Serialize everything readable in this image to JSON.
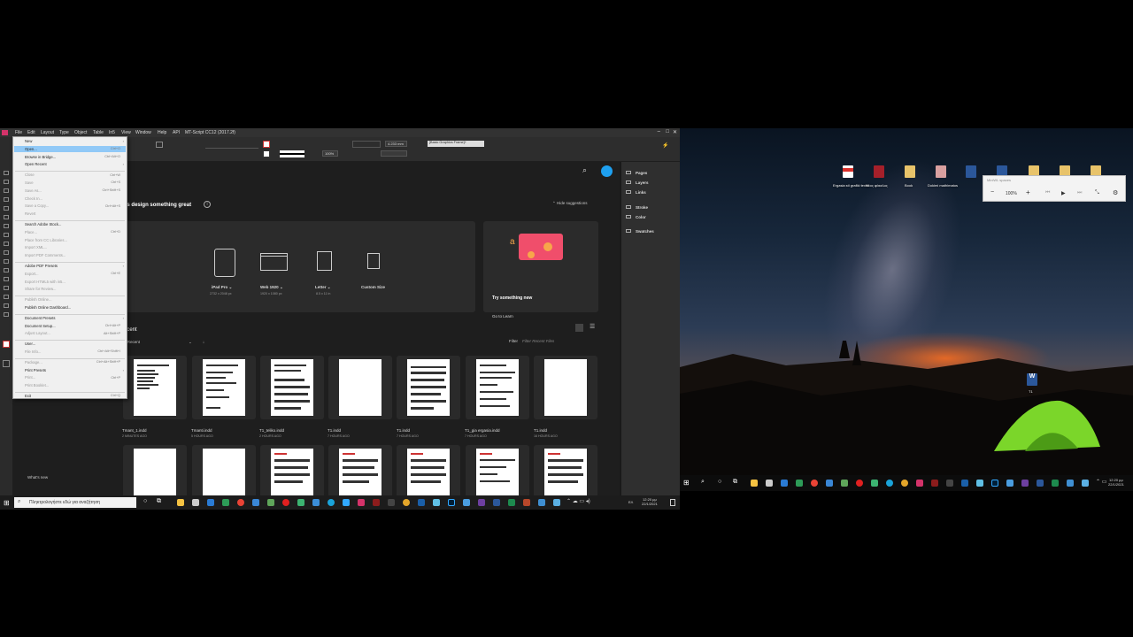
{
  "indesign": {
    "menubar": [
      "File",
      "Edit",
      "Layout",
      "Type",
      "Object",
      "Table",
      "In5",
      "View",
      "Window",
      "Help",
      "API",
      "MT-Script CC12 (2017.2f)"
    ],
    "control_fields": {
      "zoom": "100%",
      "size": "4.233 mm",
      "style": "[Basic Graphics Frame]+",
      "percent": "100%"
    },
    "file_menu": [
      {
        "label": "New",
        "shortcut": "",
        "sub": true,
        "disabled": false
      },
      {
        "label": "Open...",
        "shortcut": "Ctrl+O",
        "sub": false,
        "disabled": false,
        "highlight": true
      },
      {
        "label": "Browse in Bridge...",
        "shortcut": "Ctrl+Alt+O",
        "sub": false,
        "disabled": false
      },
      {
        "label": "Open Recent",
        "shortcut": "",
        "sub": true,
        "disabled": false
      },
      {
        "sep": true
      },
      {
        "label": "Close",
        "shortcut": "Ctrl+W",
        "sub": false,
        "disabled": true
      },
      {
        "label": "Save",
        "shortcut": "Ctrl+S",
        "sub": false,
        "disabled": true
      },
      {
        "label": "Save As...",
        "shortcut": "Ctrl+Shift+S",
        "sub": false,
        "disabled": true
      },
      {
        "label": "Check In...",
        "shortcut": "",
        "sub": false,
        "disabled": true
      },
      {
        "label": "Save a Copy...",
        "shortcut": "Ctrl+Alt+S",
        "sub": false,
        "disabled": true
      },
      {
        "label": "Revert",
        "shortcut": "",
        "sub": false,
        "disabled": true
      },
      {
        "sep": true
      },
      {
        "label": "Search Adobe Stock...",
        "shortcut": "",
        "sub": false,
        "disabled": false
      },
      {
        "label": "Place...",
        "shortcut": "Ctrl+D",
        "sub": false,
        "disabled": true
      },
      {
        "label": "Place from CC Libraries...",
        "shortcut": "",
        "sub": false,
        "disabled": true
      },
      {
        "label": "Import XML...",
        "shortcut": "",
        "sub": false,
        "disabled": true
      },
      {
        "label": "Import PDF Comments...",
        "shortcut": "",
        "sub": false,
        "disabled": true
      },
      {
        "sep": true
      },
      {
        "label": "Adobe PDF Presets",
        "shortcut": "",
        "sub": true,
        "disabled": false
      },
      {
        "label": "Export...",
        "shortcut": "Ctrl+E",
        "sub": false,
        "disabled": true
      },
      {
        "label": "Export HTML5 with in5...",
        "shortcut": "",
        "sub": false,
        "disabled": true
      },
      {
        "label": "Share for Review...",
        "shortcut": "",
        "sub": false,
        "disabled": true
      },
      {
        "sep": true
      },
      {
        "label": "Publish Online...",
        "shortcut": "",
        "sub": false,
        "disabled": true
      },
      {
        "label": "Publish Online Dashboard...",
        "shortcut": "",
        "sub": false,
        "disabled": false
      },
      {
        "sep": true
      },
      {
        "label": "Document Presets",
        "shortcut": "",
        "sub": true,
        "disabled": false
      },
      {
        "label": "Document Setup...",
        "shortcut": "Ctrl+Alt+P",
        "sub": false,
        "disabled": false
      },
      {
        "label": "Adjust Layout...",
        "shortcut": "Alt+Shift+P",
        "sub": false,
        "disabled": true
      },
      {
        "sep": true
      },
      {
        "label": "User...",
        "shortcut": "",
        "sub": false,
        "disabled": false
      },
      {
        "label": "File Info...",
        "shortcut": "Ctrl+Alt+Shift+I",
        "sub": false,
        "disabled": true
      },
      {
        "sep": true
      },
      {
        "label": "Package...",
        "shortcut": "Ctrl+Alt+Shift+P",
        "sub": false,
        "disabled": true
      },
      {
        "label": "Print Presets",
        "shortcut": "",
        "sub": true,
        "disabled": false
      },
      {
        "label": "Print...",
        "shortcut": "Ctrl+P",
        "sub": false,
        "disabled": true
      },
      {
        "label": "Print Booklet...",
        "shortcut": "",
        "sub": false,
        "disabled": true
      },
      {
        "sep": true
      },
      {
        "label": "Exit",
        "shortcut": "Ctrl+Q",
        "sub": false,
        "disabled": false
      }
    ],
    "home": {
      "headline": "t's design something great",
      "hide_suggestions": "Hide suggestions",
      "presets": [
        {
          "name": "iPad Pro",
          "size": "2732 x 2048 px"
        },
        {
          "name": "Web 1920",
          "size": "1920 x 1080 px"
        },
        {
          "name": "Letter",
          "size": "8.5 x 11 in"
        },
        {
          "name": "Custom Size",
          "size": ""
        }
      ],
      "try_title": "Try something new",
      "try_link": "Go to Learn",
      "recent_title": "ecent",
      "sort_label": "Recent",
      "sort_prefix": "t:",
      "filter_label": "Filter",
      "filter_placeholder": "Filter Recent Files",
      "files": [
        {
          "name": "Tmant_1.indd",
          "time": "2 MINUTES AGO"
        },
        {
          "name": "Tmanti.indd",
          "time": "5 HOURS AGO"
        },
        {
          "name": "T1_teliko.indd",
          "time": "2 HOURS AGO"
        },
        {
          "name": "T1.indd",
          "time": "7 HOURS AGO"
        },
        {
          "name": "T1.indd",
          "time": "7 HOURS AGO"
        },
        {
          "name": "T1_gia ergasia.indd",
          "time": "7 HOURS AGO"
        },
        {
          "name": "T1.indd",
          "time": "16 HOURS AGO"
        }
      ],
      "whats_new": "What's new"
    },
    "panels": [
      "Pages",
      "Layers",
      "Links",
      "Stroke",
      "Color",
      "Swatches"
    ]
  },
  "taskbar_left": {
    "search_placeholder": "Πληκτρολογήστε εδώ για αναζήτηση",
    "time": "12:20 μμ",
    "date": "22/1/2021",
    "lang": "ΕΛ"
  },
  "desktop": {
    "icons": [
      "Ergasia sti grafiki texni",
      "Νέος φάκελος",
      "Book",
      "Dokimi mathimatos"
    ],
    "word_doc": "T1",
    "mini_player": {
      "title": "MiniWL spaces",
      "zoom": "100%"
    }
  },
  "taskbar_right": {
    "time": "12:20 μμ",
    "date": "22/1/2021"
  },
  "colors": {
    "accent_blue": "#1473e6",
    "menu_highlight": "#91c9f7",
    "try_pink": "#f04e6b"
  }
}
